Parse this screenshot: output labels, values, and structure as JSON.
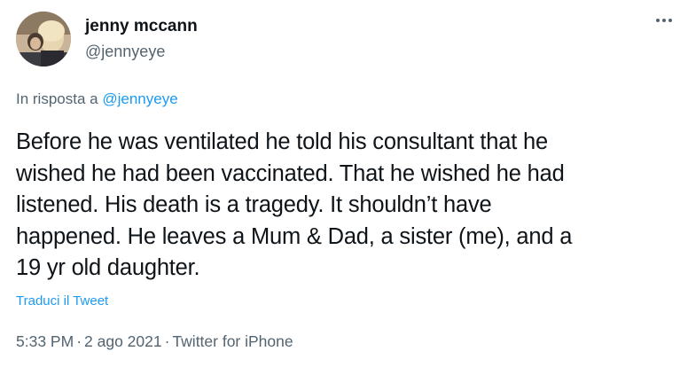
{
  "user": {
    "display_name": "jenny mccann",
    "handle": "@jennyeye",
    "avatar": "profile-photo"
  },
  "menu": {
    "icon": "more-horizontal-icon"
  },
  "reply": {
    "prefix": "In risposta a",
    "mention": "@jennyeye"
  },
  "tweet": {
    "lines": [
      "Before he was ventilated he told his consultant that he",
      "wished he had been vaccinated. That he wished he had",
      "listened. His death is a tragedy. It shouldn’t have",
      "happened. He leaves a Mum & Dad, a sister (me), and a",
      "19 yr old daughter."
    ],
    "translate_label": "Traduci il Tweet"
  },
  "meta": {
    "time": "5:33 PM",
    "date": "2 ago 2021",
    "source": "Twitter for iPhone",
    "separator": "·"
  },
  "colors": {
    "text": "#0f1419",
    "secondary": "#536471",
    "accent": "#1d9bf0"
  }
}
